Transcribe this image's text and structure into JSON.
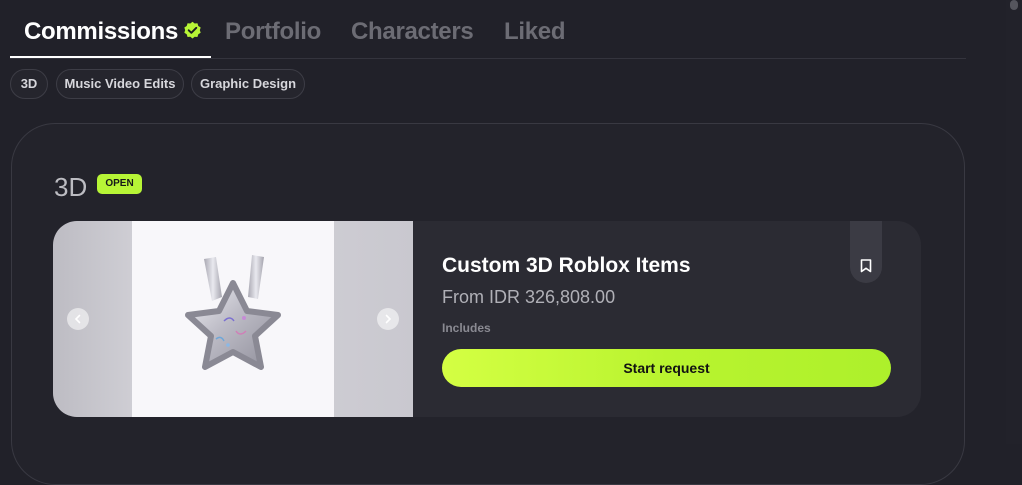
{
  "tabs": [
    {
      "label": "Commissions",
      "active": true,
      "verified": true
    },
    {
      "label": "Portfolio",
      "active": false
    },
    {
      "label": "Characters",
      "active": false
    },
    {
      "label": "Liked",
      "active": false
    }
  ],
  "filters": [
    "3D",
    "Music Video Edits",
    "Graphic Design"
  ],
  "section": {
    "title": "3D",
    "status": "OPEN",
    "status_color": "#b7f536"
  },
  "card": {
    "title": "Custom 3D Roblox Items",
    "price": "From IDR 326,808.00",
    "includes_label": "Includes",
    "cta_label": "Start request",
    "image_subject": "silver star-shaped 3D bag item",
    "gallery_prev_icon": "chevron-left-icon",
    "gallery_next_icon": "chevron-right-icon",
    "bookmark_icon": "bookmark-icon"
  },
  "colors": {
    "background": "#212129",
    "accent": "#b7f536",
    "muted_tab": "#6c6c74"
  }
}
